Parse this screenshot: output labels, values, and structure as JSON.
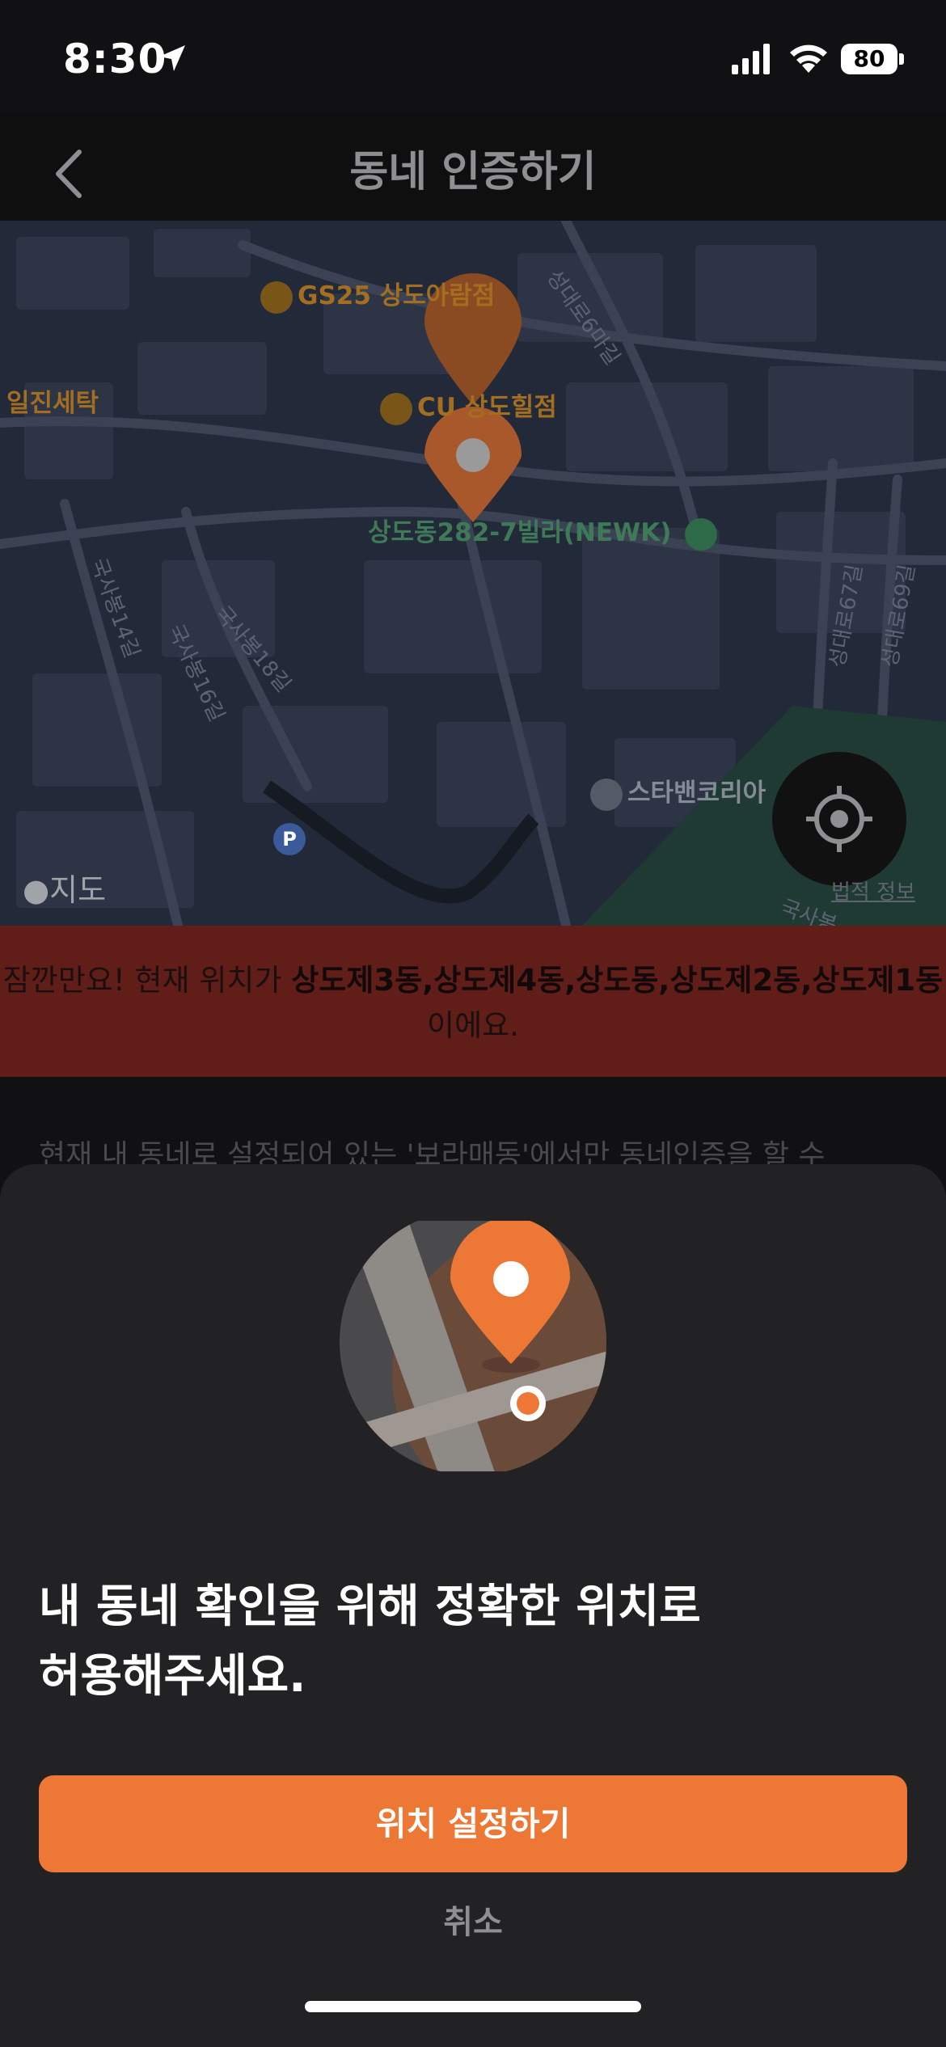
{
  "status_bar": {
    "time": "8:30",
    "battery": "80"
  },
  "nav": {
    "title": "동네 인증하기"
  },
  "map": {
    "pois": [
      "GS25 상도아람점",
      "CU 상도힐점",
      "일진세탁",
      "상도동282-7빌라(NEWK)",
      "스타밴코리아"
    ],
    "streets": [
      "성대로6마길",
      "국사봉14길",
      "국사봉16길",
      "국사봉18길",
      "성대로67길",
      "성대로69길",
      "국사봉"
    ],
    "apple_maps_label": "지도",
    "legal_label": "법적 정보"
  },
  "banner": {
    "prefix": "잠깐만요! 현재 위치가 ",
    "dongs": "상도제3동,상도제4동,상도동,상도제2동,상도제1동",
    "suffix": "이에요."
  },
  "underlying_text": "현재 내 동네로 설정되어 있는 '보라매동'에서만 동네인증을 할 수",
  "sheet": {
    "title_line1": "내 동네 확인을 위해 정확한 위치로",
    "title_line2": "허용해주세요.",
    "confirm_button": "위치 설정하기",
    "cancel_button": "취소"
  },
  "colors": {
    "accent": "#ed7735",
    "banner_bg": "#611d18",
    "sheet_bg": "#222225"
  }
}
